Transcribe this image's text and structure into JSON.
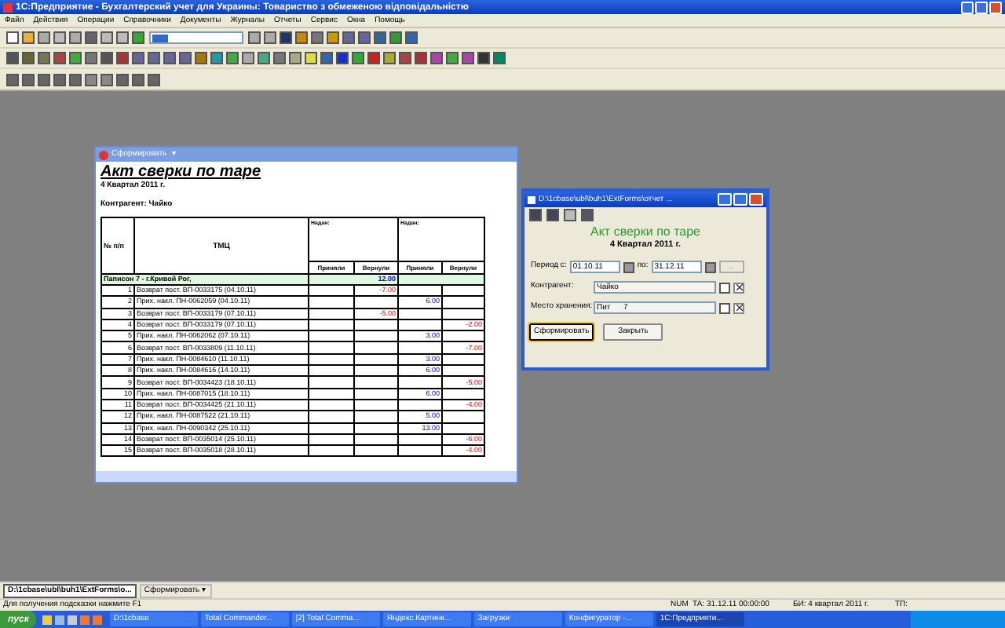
{
  "window": {
    "title": "1С:Предприятие - Бухгалтерский учет для Украины: Товариство з обмеженою відповідальністю"
  },
  "menu": [
    "Файл",
    "Действия",
    "Операции",
    "Справочники",
    "Документы",
    "Журналы",
    "Отчеты",
    "Сервис",
    "Окна",
    "Помощь"
  ],
  "report_window": {
    "title": "Сформировать",
    "menu_caret": "▾",
    "heading": "Акт сверки по таре",
    "period": "4 Квартал 2011 г.",
    "counterparty": "Контрагент: Чайко",
    "columns": {
      "number": "№ п/п",
      "item": "ТМЦ",
      "groups": [
        "Надан:",
        "Надан:"
      ],
      "values": [
        "Приняли",
        "Вернули",
        "Приняли",
        "Вернули"
      ]
    },
    "group_row": {
      "label": "Паписон 7 - г.Кривой Рог,",
      "total": "12.00"
    },
    "rows": [
      {
        "number": "1",
        "name": "Возврат пост. ВП-0033175 (04.10.11)",
        "kind": "returned1",
        "amount": "-7.00"
      },
      {
        "number": "2",
        "name": "Прих. накл. ПН-0062059 (04.10.11)",
        "kind": "received2",
        "amount": "6.00"
      },
      {
        "number": "3",
        "name": "Возврат пост. ВП-0033179 (07.10.11)",
        "kind": "returned1",
        "amount": "-5.00"
      },
      {
        "number": "4",
        "name": "Возврат пост. ВП-0033179 (07.10.11)",
        "kind": "returned2",
        "amount": "-2.00"
      },
      {
        "number": "5",
        "name": "Прих. накл. ПН-0062062 (07.10.11)",
        "kind": "received2",
        "amount": "3.00"
      },
      {
        "number": "6",
        "name": "Возврат пост. ВП-0033809 (11.10.11)",
        "kind": "returned2",
        "amount": "-7.00"
      },
      {
        "number": "7",
        "name": "Прих. накл. ПН-0084610 (11.10.11)",
        "kind": "received2",
        "amount": "3.00"
      },
      {
        "number": "8",
        "name": "Прих. накл. ПН-0084616 (14.10.11)",
        "kind": "received2",
        "amount": "6.00"
      },
      {
        "number": "9",
        "name": "Возврат пост. ВП-0034423 (18.10.11)",
        "kind": "returned2",
        "amount": "-5.00"
      },
      {
        "number": "10",
        "name": "Прих. накл. ПН-0087015 (18.10.11)",
        "kind": "received2",
        "amount": "6.00"
      },
      {
        "number": "11",
        "name": "Возврат пост. ВП-0034425 (21.10.11)",
        "kind": "returned2",
        "amount": "-4.00"
      },
      {
        "number": "12",
        "name": "Прих. накл. ПН-0087522 (21.10.11)",
        "kind": "received2",
        "amount": "5.00"
      },
      {
        "number": "13",
        "name": "Прих. накл. ПН-0090342 (25.10.11)",
        "kind": "received2",
        "amount": "13.00"
      },
      {
        "number": "14",
        "name": "Возврат пост. ВП-0035014 (25.10.11)",
        "kind": "returned2",
        "amount": "-6.00"
      },
      {
        "number": "15",
        "name": "Возврат пост. ВП-0035018 (28.10.11)",
        "kind": "returned2",
        "amount": "-4.00"
      }
    ]
  },
  "dialog": {
    "title": "D:\\1cbase\\ubl\\buh1\\ExtForms\\отчет ...",
    "heading": "Акт сверки по таре",
    "period": "4 Квартал 2011 г.",
    "period_from_label": "Период с:",
    "period_from": "01.10.11",
    "period_to_label": "по:",
    "period_to": "31.12.11",
    "period_button": "...",
    "fields": [
      {
        "label": "Контрагент:",
        "value": "Чайко"
      },
      {
        "label": "Место хранения:",
        "value": "Пит      7"
      }
    ],
    "buttons": [
      {
        "label": "Сформировать",
        "selected": true
      },
      {
        "label": "Закрыть",
        "selected": false
      }
    ]
  },
  "window_tabs": [
    {
      "label": "D:\\1cbase\\ubl\\buh1\\ExtForms\\о...",
      "selected": true
    },
    {
      "label": "Сформировать ▾",
      "selected": false
    }
  ],
  "status_bar": {
    "hint": "Для получения подсказки нажмите F1",
    "num": "NUM",
    "ta": "ТА: 31.12.11 00:00:00",
    "bi": "БИ: 4 квартал 2011 г.",
    "tp": "ТП:"
  },
  "taskbar": {
    "start": "пуск",
    "items": [
      {
        "label": "D:\\1cbase",
        "selected": false
      },
      {
        "label": "Total Commander...",
        "selected": false
      },
      {
        "label": "[2] Total Comma...",
        "selected": false
      },
      {
        "label": "Яндекс.Картинк...",
        "selected": false
      },
      {
        "label": "Загрузки",
        "selected": false
      },
      {
        "label": "Конфигуратор -...",
        "selected": false
      },
      {
        "label": "1С:Предприяти...",
        "selected": true
      }
    ]
  }
}
